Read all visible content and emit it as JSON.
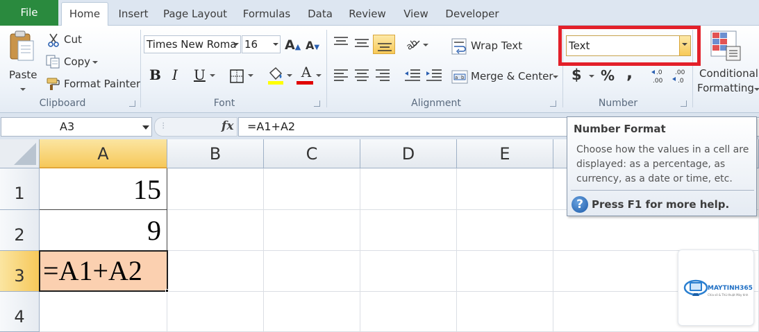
{
  "tabs": {
    "file": "File",
    "items": [
      "Home",
      "Insert",
      "Page Layout",
      "Formulas",
      "Data",
      "Review",
      "View",
      "Developer"
    ]
  },
  "clipboard": {
    "paste": "Paste",
    "cut": "Cut",
    "copy": "Copy",
    "format_painter": "Format Painter",
    "label": "Clipboard"
  },
  "font": {
    "name": "Times New Roma",
    "size": "16",
    "bold": "B",
    "italic": "I",
    "underline": "U",
    "label": "Font"
  },
  "alignment": {
    "wrap_text": "Wrap Text",
    "merge_center": "Merge & Center",
    "label": "Alignment"
  },
  "number": {
    "format_value": "Text",
    "currency": "$",
    "percent": "%",
    "comma": ",",
    "label": "Number"
  },
  "styles": {
    "conditional_line1": "Conditional",
    "conditional_line2": "Formatting"
  },
  "formula_bar": {
    "name_box": "A3",
    "fx": "fx",
    "formula": "=A1+A2"
  },
  "grid": {
    "columns": [
      "A",
      "B",
      "C",
      "D",
      "E"
    ],
    "rows": [
      "1",
      "2",
      "3",
      "4"
    ],
    "cells": {
      "A1": "15",
      "A2": "9",
      "A3": "=A1+A2"
    }
  },
  "tooltip": {
    "title": "Number Format",
    "body": "Choose how the values in a cell are displayed: as a percentage, as currency, as a date or time, etc.",
    "help_icon": "?",
    "help": "Press F1 for more help."
  },
  "watermark": {
    "brand": "MAYTINH365",
    "tagline": "Chia sẻ & Thủ thuật Máy tính"
  },
  "colors": {
    "file_tab": "#2a8a3e",
    "highlight": "#e3202a",
    "active_cell": "#fbd0b0",
    "selected_header": "#f6c85a"
  }
}
